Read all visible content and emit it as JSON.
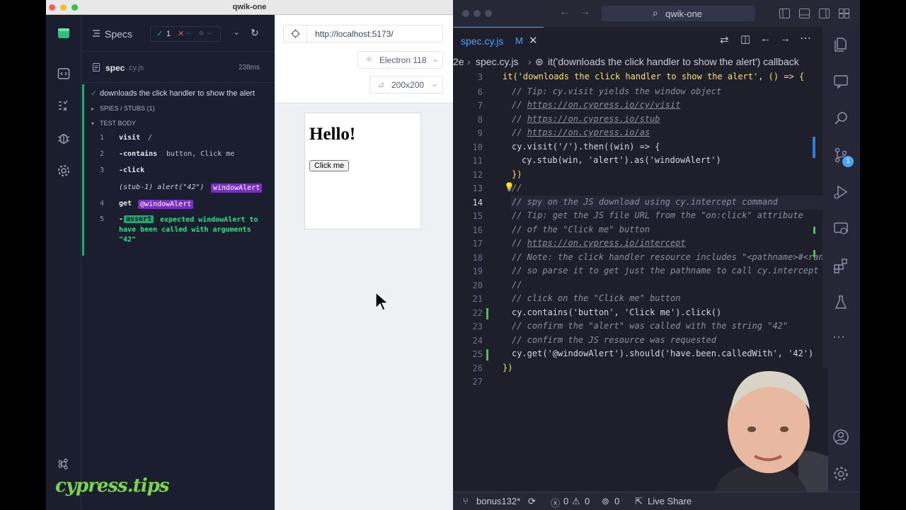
{
  "cypress": {
    "window_title": "qwik-one",
    "reporter": {
      "specs_label": "Specs",
      "stats": {
        "passed": "1",
        "failed": "--",
        "pending": "--"
      },
      "spec_name": "spec",
      "spec_ext": ".cy.js",
      "spec_duration": "238ms",
      "test_title": "downloads the click handler to show the alert",
      "spies_label": "SPIES / STUBS (1)",
      "body_label": "TEST BODY",
      "commands": [
        {
          "num": "1",
          "name": "visit",
          "msg": "/"
        },
        {
          "num": "2",
          "name": "-contains",
          "msg": "button, Click me"
        },
        {
          "num": "3",
          "name": "-click",
          "msg": ""
        },
        {
          "num": "",
          "name": "",
          "msg": "(stub-1)  alert(\"42\")",
          "badge": "windowAlert"
        },
        {
          "num": "4",
          "name": "get",
          "msg": "",
          "badge": "@windowAlert"
        },
        {
          "num": "5",
          "name": "-",
          "badge": "assert",
          "msg": "expected windowAlert to have been called with arguments \"42\""
        }
      ]
    },
    "aut": {
      "url": "http://localhost:5173/",
      "browser": "Electron 118",
      "viewport": "200x200",
      "heading": "Hello!",
      "button_label": "Click me"
    },
    "watermark": "cypress.tips"
  },
  "vscode": {
    "title_search": "qwik-one",
    "tab_name": "spec.cy.js",
    "tab_modified": "M",
    "breadcrumb_file": "spec.cy.js",
    "breadcrumb_symbol": "it('downloads the click handler to show the alert') callback",
    "breadcrumb_prefix": "2e",
    "lines": [
      {
        "n": "3",
        "text": "it('downloads the click handler to show the alert', () => {"
      },
      {
        "n": "6",
        "text": "// Tip: cy.visit yields the window object"
      },
      {
        "n": "7",
        "text": "https://on.cypress.io/cy/visit"
      },
      {
        "n": "8",
        "text": "https://on.cypress.io/stub"
      },
      {
        "n": "9",
        "text": "https://on.cypress.io/as"
      },
      {
        "n": "10",
        "text": "cy.visit('/').then((win) => {"
      },
      {
        "n": "11",
        "text": "cy.stub(win, 'alert').as('windowAlert')"
      },
      {
        "n": "12",
        "text": "})"
      },
      {
        "n": "13",
        "text": "//"
      },
      {
        "n": "14",
        "text": "// spy on the JS download using cy.intercept command"
      },
      {
        "n": "15",
        "text": "// Tip: get the JS file URL from the \"on:click\" attribute"
      },
      {
        "n": "16",
        "text": "// of the \"Click me\" button"
      },
      {
        "n": "17",
        "text": "https://on.cypress.io/intercept"
      },
      {
        "n": "18",
        "text": "// Note: the click handler resource includes \"<pathname>#<rando"
      },
      {
        "n": "19",
        "text": "// so parse it to get just the pathname to call cy.intercept"
      },
      {
        "n": "20",
        "text": "//"
      },
      {
        "n": "21",
        "text": "// click on the \"Click me\" button"
      },
      {
        "n": "22",
        "text": "cy.contains('button', 'Click me').click()"
      },
      {
        "n": "23",
        "text": "// confirm the \"alert\" was called with the string \"42\""
      },
      {
        "n": "24",
        "text": "// confirm the JS resource was requested"
      },
      {
        "n": "25",
        "text": "cy.get('@windowAlert').should('have.been.calledWith', '42')"
      },
      {
        "n": "26",
        "text": "})"
      },
      {
        "n": "27",
        "text": ""
      }
    ],
    "active_line": "14",
    "status": {
      "branch": "bonus132*",
      "errors": "0",
      "warnings": "0",
      "ports": "0",
      "live_share": "Live Share"
    },
    "source_control_badge": "1"
  },
  "colors": {
    "cypress_bg": "#1b1e2e",
    "pass_green": "#1fa971",
    "alias_purple": "#7b2fbe",
    "vscode_bg": "#1e1f2b",
    "accent_blue": "#4aa3ff"
  }
}
